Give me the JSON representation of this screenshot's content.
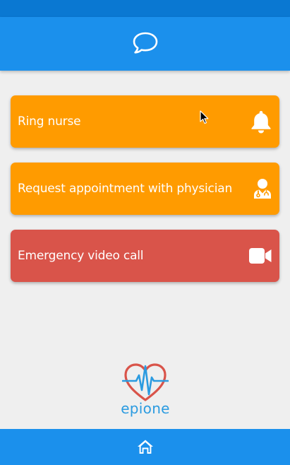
{
  "app": {
    "name": "epione"
  },
  "colors": {
    "status_bar": "#0a78d2",
    "primary": "#1b90ec",
    "background": "#efefef",
    "card_orange": "#ff9b00",
    "card_red": "#d9544a",
    "logo_heart": "#d9544a",
    "logo_pulse": "#2b9be0",
    "text_on_card": "#ffffff"
  },
  "header": {
    "icon": "chat-bubble-icon"
  },
  "actions": [
    {
      "label": "Ring nurse",
      "icon": "bell-icon",
      "color": "#ff9b00"
    },
    {
      "label": "Request appointment with physician",
      "icon": "physician-icon",
      "color": "#ff9b00"
    },
    {
      "label": "Emergency video call",
      "icon": "video-camera-icon",
      "color": "#d9544a"
    }
  ],
  "logo": {
    "text": "epione",
    "icon": "heart-pulse-icon"
  },
  "bottom_nav": {
    "icon": "home-icon"
  }
}
